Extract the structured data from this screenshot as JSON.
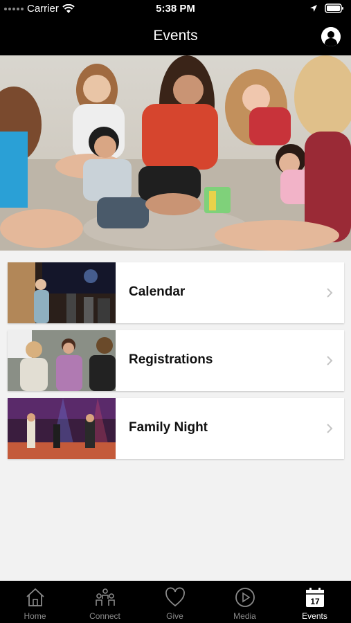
{
  "status_bar": {
    "carrier": "Carrier",
    "time": "5:38 PM"
  },
  "nav": {
    "title": "Events",
    "profile_icon": "person-icon"
  },
  "hero": {
    "description_icon": "photo"
  },
  "cards": [
    {
      "label": "Calendar",
      "icon": "chevron-right-icon"
    },
    {
      "label": "Registrations",
      "icon": "chevron-right-icon"
    },
    {
      "label": "Family Night",
      "icon": "chevron-right-icon"
    }
  ],
  "tabs": [
    {
      "label": "Home",
      "icon": "house-icon",
      "active": false
    },
    {
      "label": "Connect",
      "icon": "people-icon",
      "active": false
    },
    {
      "label": "Give",
      "icon": "heart-icon",
      "active": false
    },
    {
      "label": "Media",
      "icon": "play-icon",
      "active": false
    },
    {
      "label": "Events",
      "icon": "calendar-icon",
      "active": true,
      "badge": "17"
    }
  ],
  "colors": {
    "bar": "#000000",
    "background": "#f2f2f2",
    "card": "#ffffff",
    "tab_inactive": "#8a8a8a",
    "tab_active": "#ffffff"
  }
}
